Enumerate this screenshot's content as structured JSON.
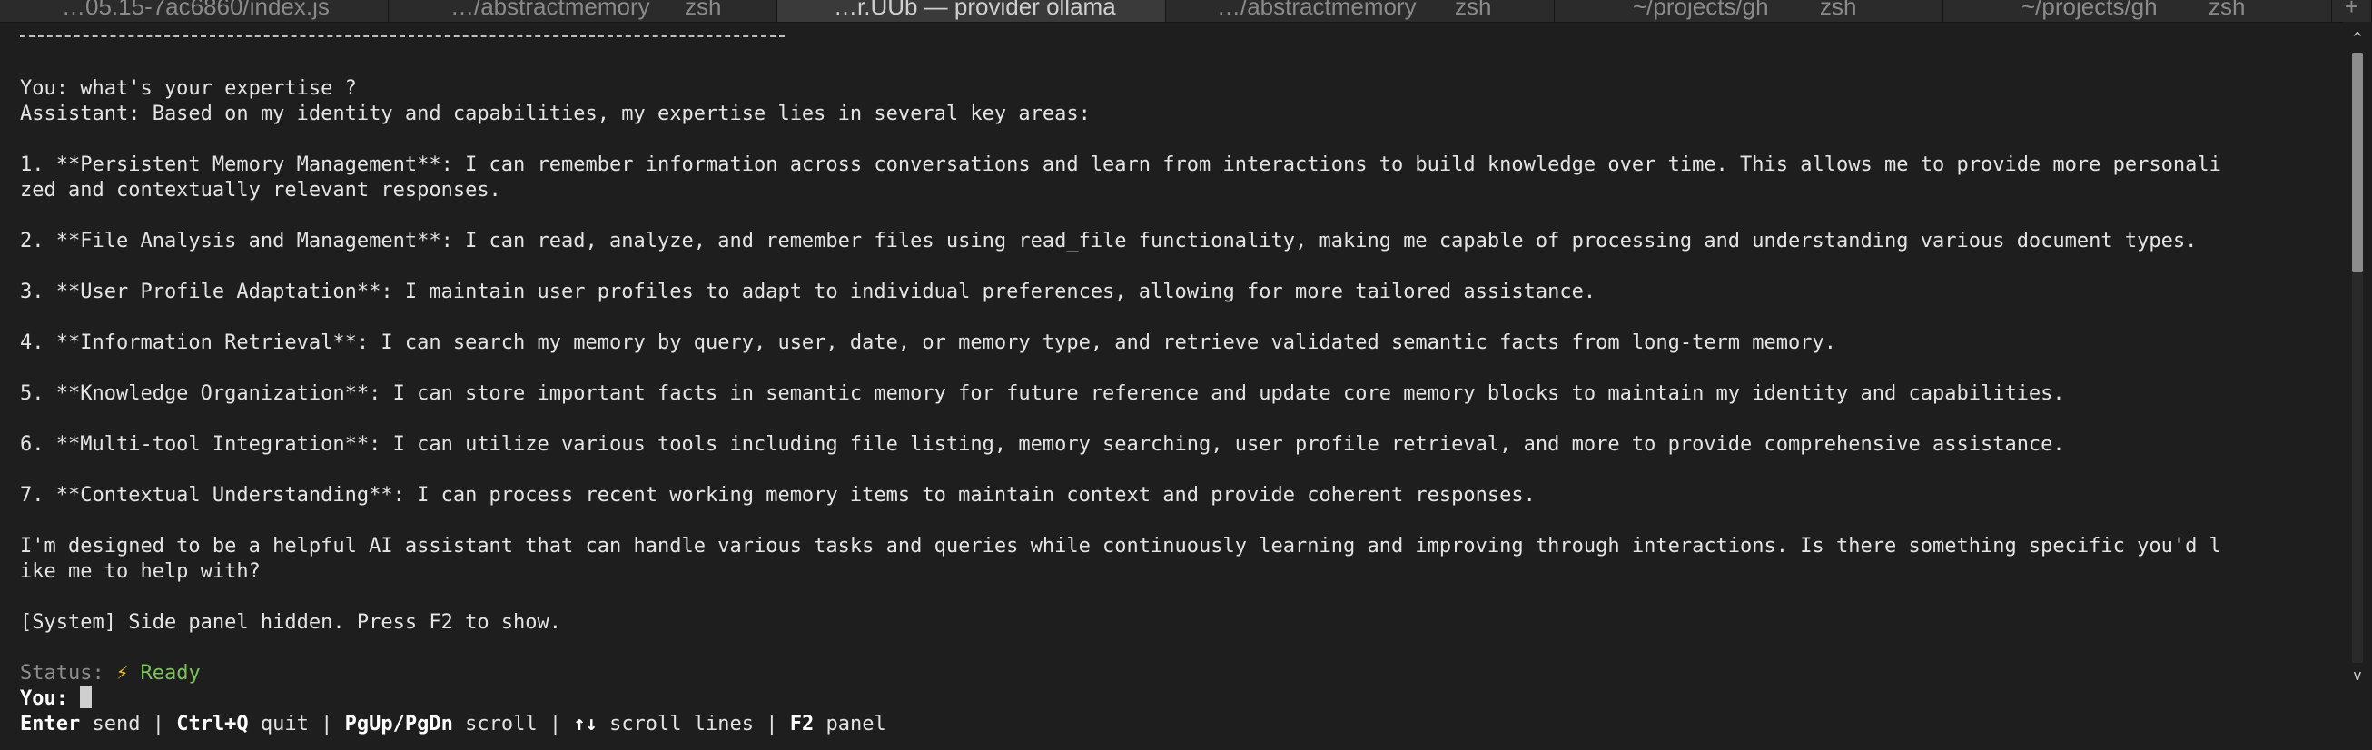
{
  "tabs": [
    {
      "title": "…05.15-7ac6860/index.js",
      "process": "",
      "active": false
    },
    {
      "title": "…/abstractmemory",
      "process": "zsh",
      "active": false
    },
    {
      "title": "…r.UUb — provider ollama",
      "process": "",
      "active": true
    },
    {
      "title": "…/abstractmemory",
      "process": "zsh",
      "active": false
    },
    {
      "title": "~/projects/gh",
      "process": "zsh",
      "active": false
    },
    {
      "title": "~/projects/gh",
      "process": "zsh",
      "active": false
    }
  ],
  "tab_more_glyph": "…",
  "tab_overflow_label": "+",
  "conversation": {
    "user_question": "You: what's your expertise ?",
    "assistant_intro": "Assistant: Based on my identity and capabilities, my expertise lies in several key areas:",
    "items": [
      "1. **Persistent Memory Management**: I can remember information across conversations and learn from interactions to build knowledge over time. This allows me to provide more personali",
      "zed and contextually relevant responses.",
      "2. **File Analysis and Management**: I can read, analyze, and remember files using read_file functionality, making me capable of processing and understanding various document types.",
      "3. **User Profile Adaptation**: I maintain user profiles to adapt to individual preferences, allowing for more tailored assistance.",
      "4. **Information Retrieval**: I can search my memory by query, user, date, or memory type, and retrieve validated semantic facts from long-term memory.",
      "5. **Knowledge Organization**: I can store important facts in semantic memory for future reference and update core memory blocks to maintain my identity and capabilities.",
      "6. **Multi-tool Integration**: I can utilize various tools including file listing, memory searching, user profile retrieval, and more to provide comprehensive assistance.",
      "7. **Contextual Understanding**: I can process recent working memory items to maintain context and provide coherent responses."
    ],
    "closing": [
      "I'm designed to be a helpful AI assistant that can handle various tasks and queries while continuously learning and improving through interactions. Is there something specific you'd l",
      "ike me to help with?"
    ],
    "system_message": "[System] Side panel hidden. Press F2 to show."
  },
  "status": {
    "label": "Status:",
    "icon": "⚡",
    "value": "Ready"
  },
  "prompt": {
    "label": "You:",
    "value": ""
  },
  "shortcuts": {
    "k1": "Enter",
    "d1": " send | ",
    "k2": "Ctrl+Q",
    "d2": " quit | ",
    "k3": "PgUp/PgDn",
    "d3": " scroll | ",
    "k4": "↑↓",
    "d4": " scroll lines | ",
    "k5": "F2",
    "d5": " panel"
  },
  "scroll": {
    "up_glyph": "^",
    "down_glyph": "v",
    "thumb_start": 0.0,
    "thumb_fraction": 0.36
  },
  "colors": {
    "background": "#1e1e1e",
    "ready": "#7cc35a",
    "status_label": "#8c8c8c"
  }
}
